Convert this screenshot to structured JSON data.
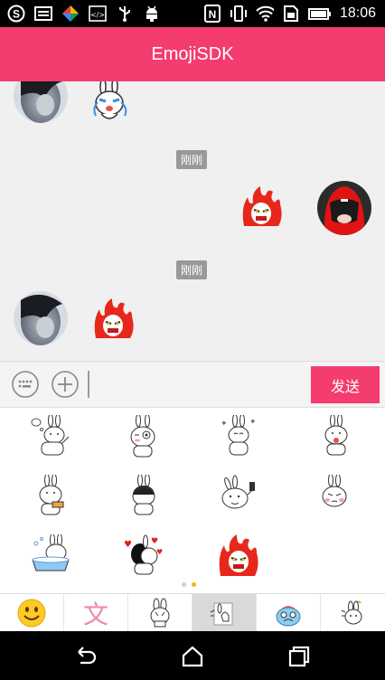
{
  "status_bar": {
    "time": "18:06",
    "left_icons": [
      "skype-icon",
      "gallery-icon",
      "colorful-app-icon",
      "code-icon",
      "usb-icon",
      "android-debug-icon"
    ],
    "right_icons": [
      "nfc-icon",
      "vibrate-icon",
      "wifi-icon",
      "sim-icon",
      "battery-icon"
    ]
  },
  "app_bar": {
    "title": "EmojiSDK",
    "color": "#F43C6E"
  },
  "chat": {
    "messages": [
      {
        "side": "left",
        "sticker": "rabbit-crying-sticker"
      },
      {
        "timestamp": "刚刚"
      },
      {
        "side": "right",
        "sticker": "fire-angry-sticker"
      },
      {
        "timestamp": "刚刚"
      },
      {
        "side": "left",
        "sticker": "fire-angry-sticker"
      }
    ]
  },
  "input_bar": {
    "send_label": "发送",
    "emoji_icon": "emoji-keyboard-icon",
    "plus_icon": "plus-circle-icon"
  },
  "sticker_grid": {
    "rows": [
      [
        "rabbit-thinking",
        "rabbit-wink",
        "rabbit-sparkle",
        "rabbit-tongue"
      ],
      [
        "rabbit-eating",
        "rabbit-shadow",
        "rabbit-phone",
        "rabbit-blush"
      ],
      [
        "rabbit-bath",
        "rabbit-love",
        "fire-angry"
      ]
    ],
    "page_indicator": {
      "pages": 2,
      "active": 2
    }
  },
  "sticker_tabs": [
    {
      "icon": "smiley-emoji-icon",
      "selected": false
    },
    {
      "icon": "text-wen-icon",
      "label": "文",
      "selected": false
    },
    {
      "icon": "rabbit-pack-icon",
      "selected": false
    },
    {
      "icon": "rabbit-wave-pack-icon",
      "selected": true
    },
    {
      "icon": "blue-monster-pack-icon",
      "selected": false
    },
    {
      "icon": "rabbit-sprout-pack-icon",
      "selected": false
    }
  ],
  "nav_bar": {
    "icons": [
      "back-icon",
      "home-icon",
      "recents-icon"
    ]
  }
}
